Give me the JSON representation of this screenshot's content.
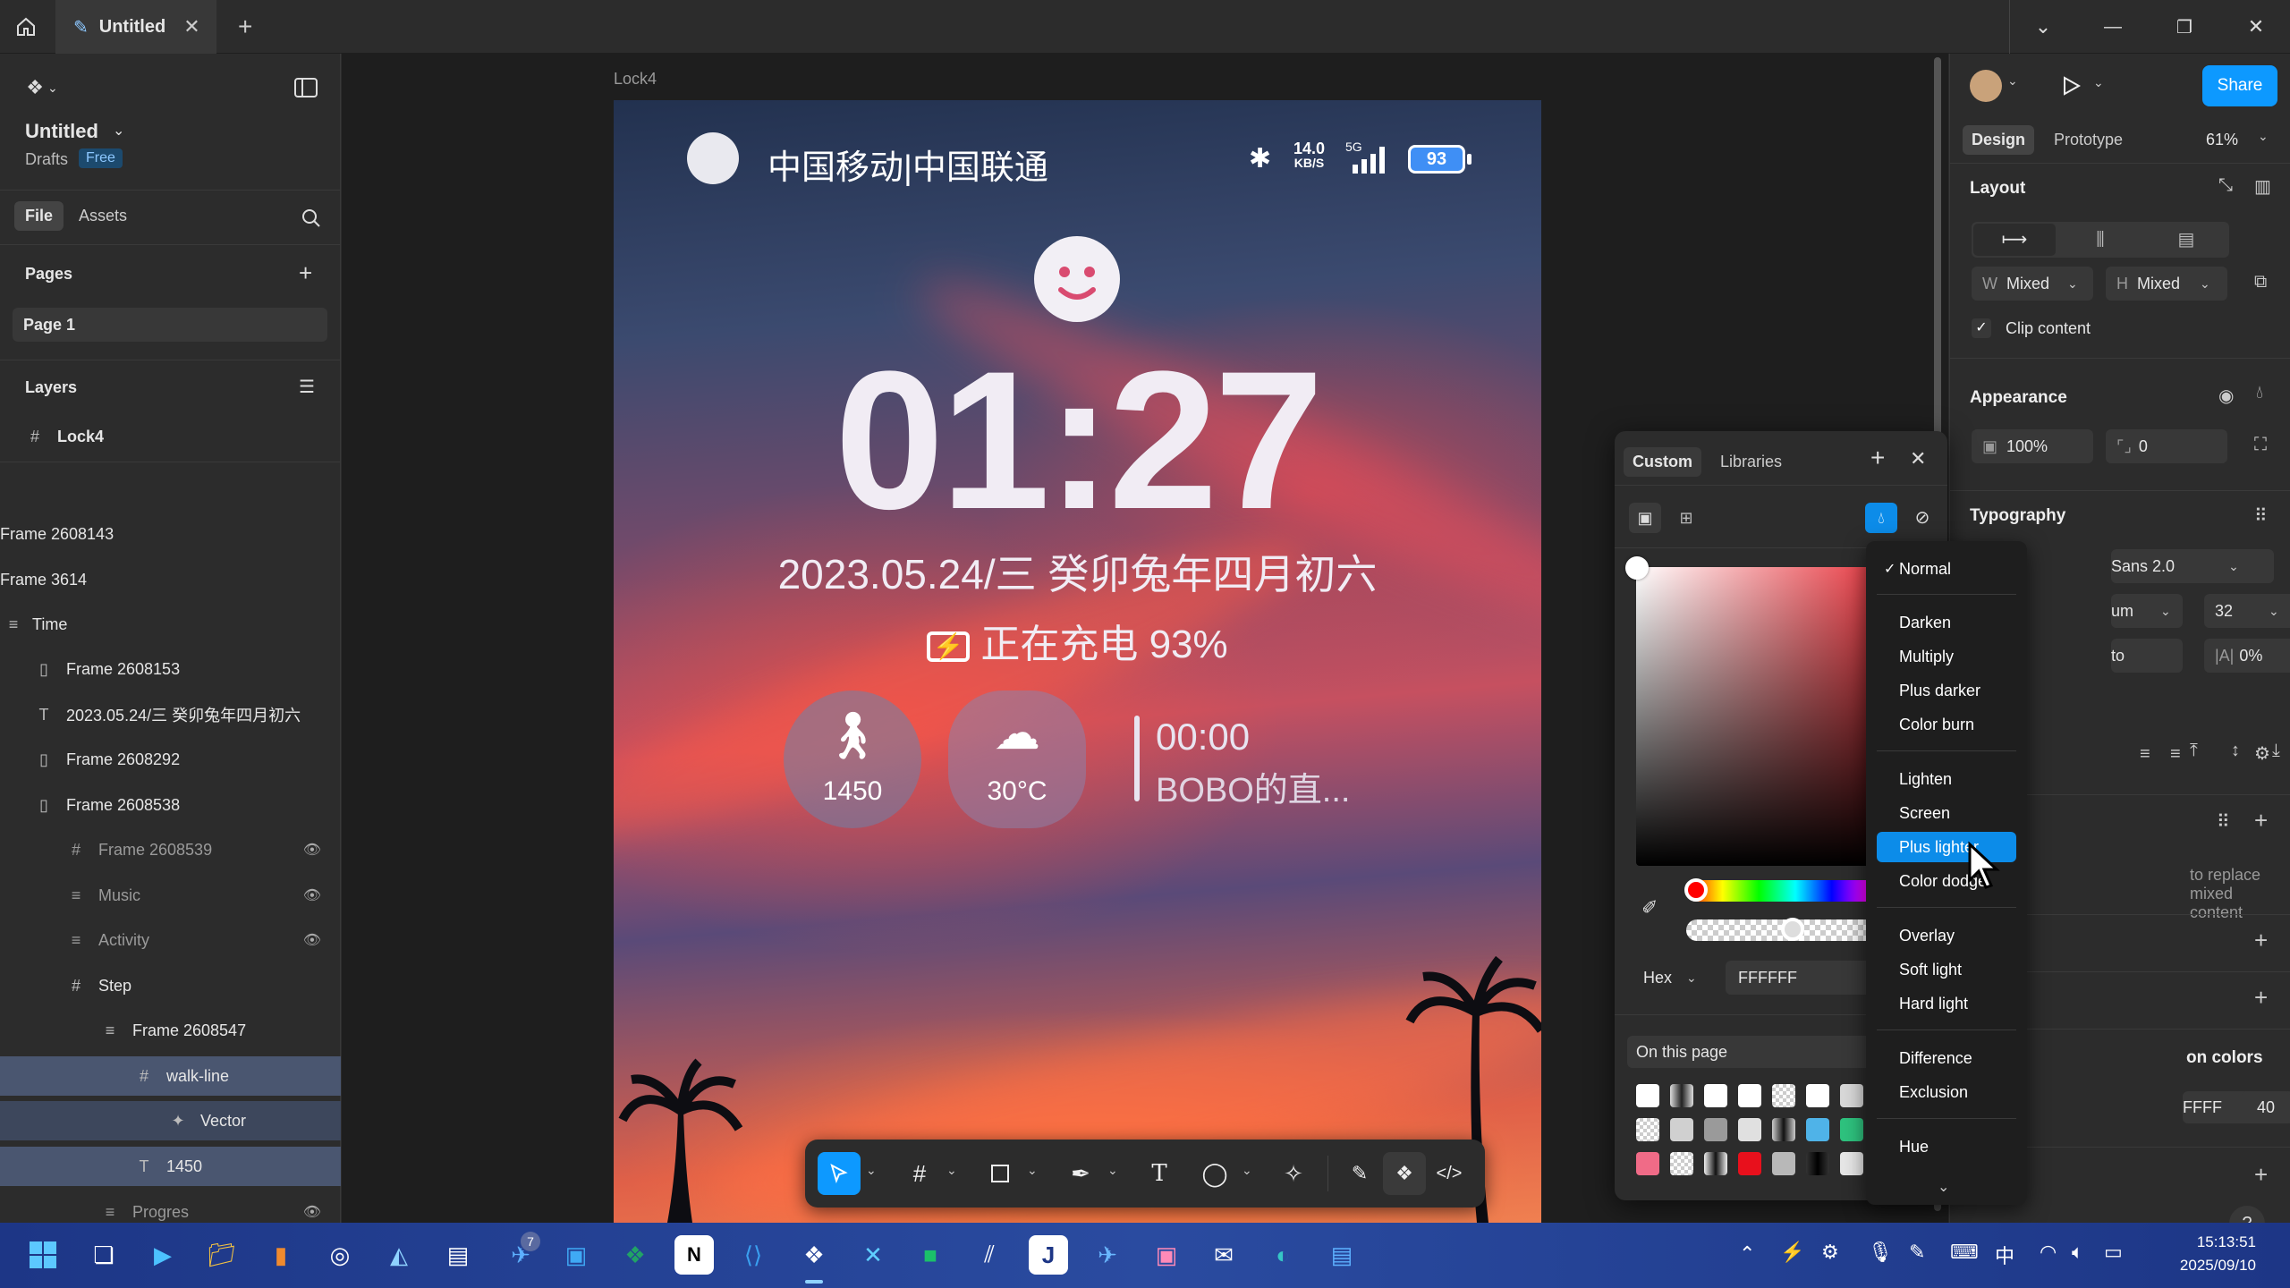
{
  "titlebar": {
    "tab_title": "Untitled",
    "new_tab": "+"
  },
  "file": {
    "name": "Untitled",
    "location": "Drafts",
    "plan": "Free"
  },
  "left_tabs": {
    "file": "File",
    "assets": "Assets"
  },
  "pages": {
    "header": "Pages",
    "items": [
      "Page 1"
    ]
  },
  "layers": {
    "header": "Layers",
    "top": "Lock4",
    "items": [
      "Frame 2608143",
      "Frame 3614",
      "Time",
      "Frame 2608153",
      "2023.05.24/三 癸卯兔年四月初六",
      "Frame 2608292",
      "Frame 2608538",
      "Frame 2608539",
      "Music",
      "Activity",
      "Step",
      "Frame 2608547",
      "walk-line",
      "Vector",
      "1450",
      "Progres"
    ]
  },
  "canvas": {
    "frame_label": "Lock4",
    "phone": {
      "carrier": "中国移动|中国联通",
      "speed_top": "14.0",
      "speed_unit": "KB/S",
      "network": "5G",
      "battery": "93",
      "time": "01:27",
      "date": "2023.05.24/三  癸卯兔年四月初六",
      "charging": "正在充电 93%",
      "steps": "1450",
      "temperature": "30°C",
      "music_time": "00:00",
      "music_title": "BOBO的直..."
    }
  },
  "right_panel": {
    "share": "Share",
    "tabs": {
      "design": "Design",
      "prototype": "Prototype"
    },
    "zoom": "61%",
    "layout": {
      "header": "Layout",
      "w_label": "W",
      "w_value": "Mixed",
      "h_label": "H",
      "h_value": "Mixed",
      "clip_content": "Clip content"
    },
    "appearance": {
      "header": "Appearance",
      "opacity": "100%",
      "radius": "0"
    },
    "typography": {
      "header": "Typography",
      "font": "Sans 2.0",
      "weight": "um",
      "size": "32",
      "line_height": "to",
      "letter_spacing": "0%"
    },
    "fill_hint": "to replace mixed content",
    "selection_colors": {
      "header": "on colors",
      "hex": "FFFF",
      "opacity": "40",
      "pct": "%"
    }
  },
  "color_picker": {
    "tabs": {
      "custom": "Custom",
      "libraries": "Libraries"
    },
    "format": "Hex",
    "hex": "FFFFFF",
    "on_this_page": "On this page"
  },
  "blend_menu": {
    "groups": [
      [
        "Normal"
      ],
      [
        "Darken",
        "Multiply",
        "Plus darker",
        "Color burn"
      ],
      [
        "Lighten",
        "Screen",
        "Plus lighter",
        "Color dodge"
      ],
      [
        "Overlay",
        "Soft light",
        "Hard light"
      ],
      [
        "Difference",
        "Exclusion"
      ],
      [
        "Hue"
      ]
    ],
    "checked": "Normal",
    "highlighted": "Plus lighter"
  },
  "taskbar": {
    "time": "15:13:51",
    "date": "2025/09/10",
    "badge": "7",
    "ime": "中"
  },
  "colors": {
    "accent": "#0d99ff",
    "selection": "#4a5670",
    "highlight": "#0c8ce9"
  }
}
